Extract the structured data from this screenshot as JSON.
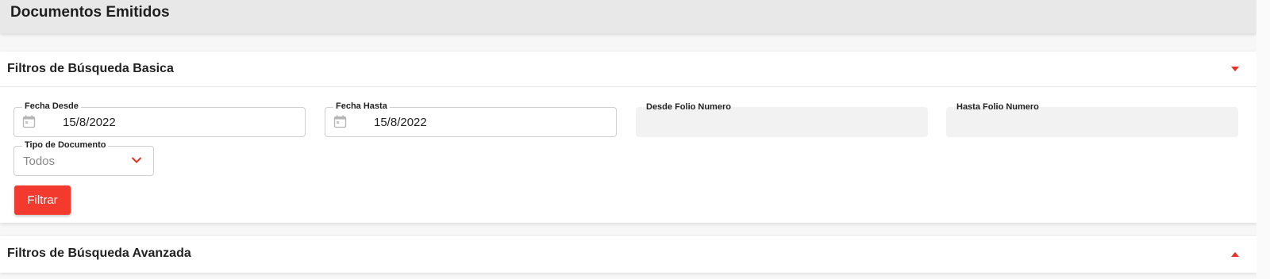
{
  "header": {
    "title": "Documentos Emitidos"
  },
  "basic_filters": {
    "title": "Filtros de Búsqueda Basica",
    "toggle_icon": "caret-down-icon",
    "fecha_desde": {
      "label": "Fecha Desde",
      "value": "15/8/2022",
      "icon": "calendar-icon"
    },
    "fecha_hasta": {
      "label": "Fecha Hasta",
      "value": "15/8/2022",
      "icon": "calendar-icon"
    },
    "desde_folio": {
      "label": "Desde Folio Numero",
      "value": ""
    },
    "hasta_folio": {
      "label": "Hasta Folio Numero",
      "value": ""
    },
    "tipo_documento": {
      "label": "Tipo de Documento",
      "value": "Todos",
      "icon": "chevron-down-icon"
    },
    "filter_button": "Filtrar"
  },
  "advanced_filters": {
    "title": "Filtros de Búsqueda Avanzada",
    "toggle_icon": "caret-up-icon"
  },
  "colors": {
    "accent": "#f23a2f",
    "header_bg": "#e8e8e8",
    "filled_field_bg": "#f2f2f2"
  }
}
